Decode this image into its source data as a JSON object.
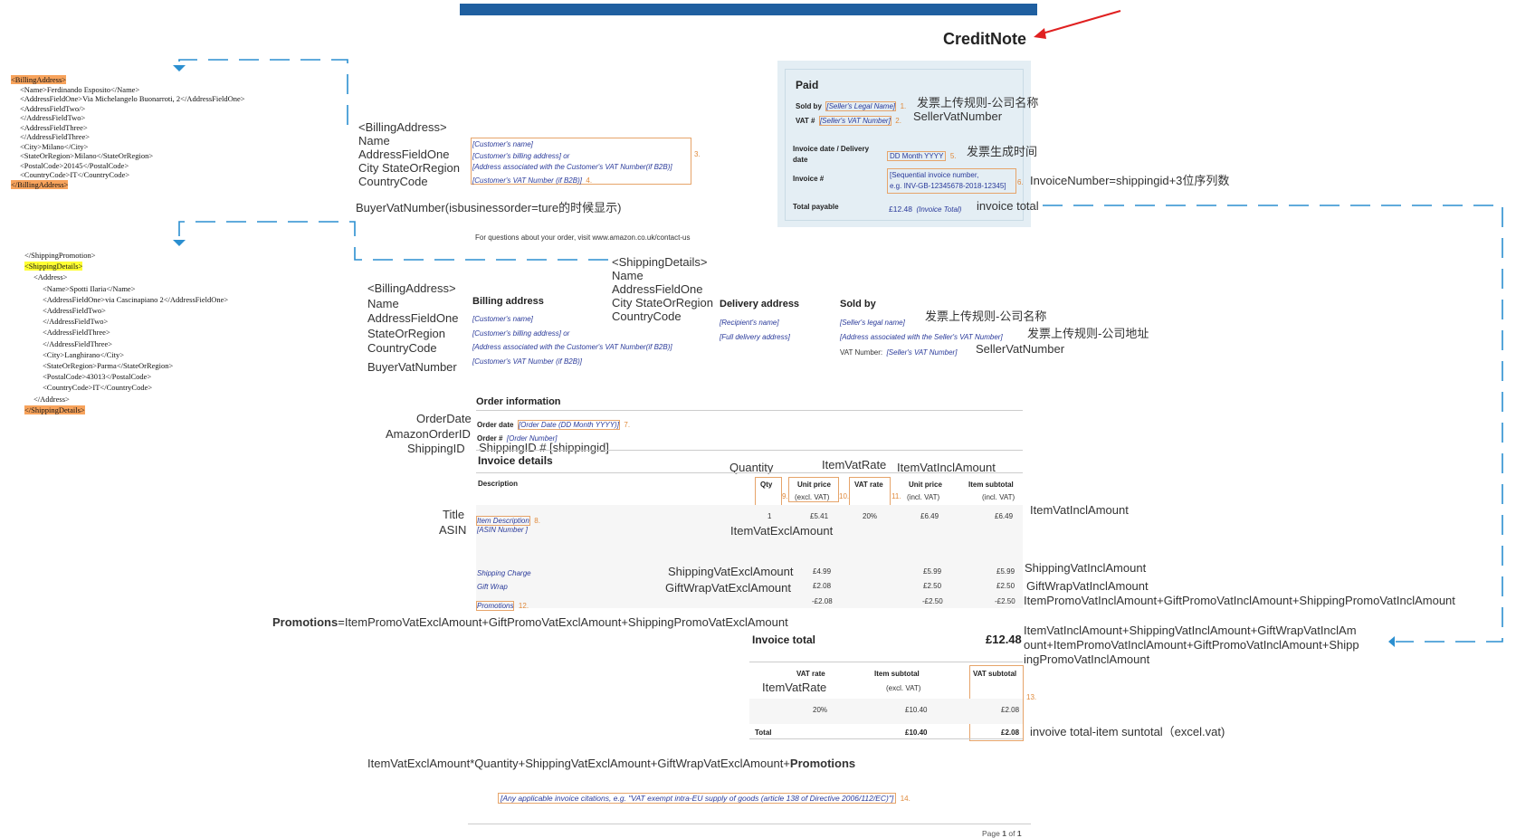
{
  "doc_title": "CreditNote",
  "xml_billing": {
    "lines": [
      "<BillingAddress>",
      "  <Name>Ferdinando Esposito</Name>",
      "  <AddressFieldOne>Via Michelangelo Buonarroti, 2</AddressFieldOne>",
      "  <AddressFieldTwo/>",
      "  </AddressFieldTwo>",
      "  <AddressFieldThree>",
      "  </AddressFieldThree>",
      "  <City>Milano</City>",
      "  <StateOrRegion>Milano</StateOrRegion>",
      "  <PostalCode>20145</PostalCode>",
      "  <CountryCode>IT</CountryCode>",
      "</BillingAddress>"
    ]
  },
  "xml_shipping": {
    "lines": [
      "</ShippingPromotion>",
      "<ShippingDetails>",
      "  <Address>",
      "    <Name>Spotti Ilaria</Name>",
      "    <AddressFieldOne>via Cascinapiano 2</AddressFieldOne>",
      "    <AddressFieldTwo>",
      "    </AddressFieldTwo>",
      "    <AddressFieldThree>",
      "    </AddressFieldThree>",
      "    <City>Langhirano</City>",
      "    <StateOrRegion>Parma</StateOrRegion>",
      "    <PostalCode>43013</PostalCode>",
      "    <CountryCode>IT</CountryCode>",
      "  </Address>",
      "</ShippingDetails>"
    ]
  },
  "map_billing_1": {
    "tag": "<BillingAddress>",
    "name": "Name",
    "addr1": "AddressFieldOne",
    "city_state": "City  StateOrRegion",
    "country": "CountryCode",
    "buyer_vat": "BuyerVatNumber(isbusinessorder=ture的时候显示)"
  },
  "paid_box": {
    "title": "Paid",
    "sold_by_label": "Sold by",
    "sold_by_ph": "[Seller's Legal Name]",
    "sold_by_num": "1.",
    "sold_by_note": "发票上传规则-公司名称",
    "vat_label": "VAT #",
    "vat_ph": "[Seller's VAT Number]",
    "vat_num": "2.",
    "vat_note": "SellerVatNumber",
    "date_label": "Invoice date / Delivery date",
    "date_ph": "DD Month YYYY",
    "date_num": "5.",
    "date_note": "发票生成时间",
    "inv_label": "Invoice #",
    "inv_ph1": "[Sequential invoice number,",
    "inv_ph2": "e.g. INV-GB-12345678-2018-12345]",
    "inv_num": "6.",
    "inv_note": "InvoiceNumber=shippingid+3位序列数",
    "total_label": "Total payable",
    "total_value": "£12.48",
    "total_ph": "(Invoice Total)",
    "total_note": "invoice total"
  },
  "customer_block": {
    "l1": "[Customer's name]",
    "l2": "[Customer's billing address] or",
    "l3": "[Address associated with the Customer's VAT Number(if B2B)]",
    "l4": "[Customer's VAT Number (if B2B)]",
    "n3": "3.",
    "n4": "4."
  },
  "contact_line": "For questions about your order, visit www.amazon.co.uk/contact-us",
  "map_shipping": {
    "tag": "<ShippingDetails>",
    "name": "Name",
    "addr1": "AddressFieldOne",
    "city_state": "City  StateOrRegion",
    "country": "CountryCode"
  },
  "map_billing_2": {
    "tag": "<BillingAddress>",
    "name": "Name",
    "addr1": "AddressFieldOne",
    "state": "StateOrRegion",
    "country": "CountryCode",
    "buyer_vat": "BuyerVatNumber"
  },
  "billing_section": {
    "heading": "Billing address",
    "l1": "[Customer's name]",
    "l2": "[Customer's billing address] or",
    "l3": "[Address associated with the Customer's VAT Number(if B2B)]",
    "l4": "[Customer's VAT Number (if B2B)]"
  },
  "delivery_section": {
    "heading": "Delivery address",
    "l1": "[Recipient's name]",
    "l2": "[Full delivery address]"
  },
  "soldby_section": {
    "heading": "Sold by",
    "l1": "[Seller's legal name]",
    "l2": "[Address associated with the Seller's VAT Number]",
    "vat_prefix": "VAT Number:",
    "vat_ph": "[Seller's VAT Number]",
    "note1": "发票上传规则-公司名称",
    "note2": "发票上传规则-公司地址",
    "note3": "SellerVatNumber"
  },
  "order_info": {
    "heading": "Order information",
    "date_label": "Order date",
    "date_ph": "[Order Date (DD Month YYYY)]",
    "date_num": "7.",
    "order_label": "Order #",
    "order_ph": "[Order Number]",
    "map_order_date": "OrderDate",
    "map_order_id": "AmazonOrderID",
    "map_shipping_id": "ShippingID",
    "shipping_line": "ShippingID # [shippingid]"
  },
  "invoice_details": {
    "heading": "Invoice details",
    "map_quantity": "Quantity",
    "map_vat_rate": "ItemVatRate",
    "map_vat_incl": "ItemVatInclAmount",
    "col_description": "Description",
    "col_qty": "Qty",
    "col_unit_price": "Unit price",
    "col_unit_price_sub": "(excl. VAT)",
    "col_vat_rate": "VAT rate",
    "col_unit_price2": "Unit price",
    "col_unit_price2_sub": "(incl. VAT)",
    "col_item_subtotal": "Item subtotal",
    "col_item_subtotal_sub": "(incl. VAT)",
    "n9": "9.",
    "n10": "10.",
    "n11": "11.",
    "map_title": "Title",
    "map_asin": "ASIN",
    "item_desc_ph": "Item Description",
    "n8": "8.",
    "asin_ph": "[ASIN Number ]",
    "item_qty": "1",
    "item_unit_excl": "£5.41",
    "item_vat": "20%",
    "item_unit_incl": "£6.49",
    "item_subtotal": "£6.49",
    "map_item_vat_incl_right": "ItemVatInclAmount",
    "map_item_vat_excl": "ItemVatExclAmount",
    "shipping_label": "Shipping Charge",
    "shipping_excl": "£4.99",
    "shipping_incl": "£5.99",
    "shipping_sub": "£5.99",
    "map_shipping_excl": "ShippingVatExclAmount",
    "map_shipping_incl": "ShippingVatInclAmount",
    "giftwrap_label": "Gift Wrap",
    "giftwrap_excl": "£2.08",
    "giftwrap_incl": "£2.50",
    "giftwrap_sub": "£2.50",
    "map_giftwrap_excl": "GiftWrapVatExclAmount",
    "map_giftwrap_incl": "GiftWrapVatInclAmount",
    "promo_label": "Promotions",
    "n12": "12.",
    "promo_excl": "-£2.08",
    "promo_incl": "-£2.50",
    "promo_sub": "-£2.50",
    "map_promo_incl": "ItemPromoVatInclAmount+GiftPromoVatInclAmount+ShippingPromoVatInclAmount",
    "promo_formula_bold": "Promotions",
    "promo_formula_rest": "=ItemPromoVatExclAmount+GiftPromoVatExclAmount+ShippingPromoVatExclAmount"
  },
  "invoice_total": {
    "label": "Invoice total",
    "value": "£12.48",
    "formula_1": "ItemVatInclAmount+ShippingVatInclAmount+GiftWrapVatInclAm",
    "formula_2": "ount+ItemPromoVatInclAmount+GiftPromoVatInclAmount+Shipp",
    "formula_3": "ingPromoVatInclAmount"
  },
  "vat_summary": {
    "col_rate": "VAT rate",
    "map_rate": "ItemVatRate",
    "col_subtotal": "Item subtotal",
    "col_subtotal_sub": "(excl. VAT)",
    "col_vat_subtotal": "VAT subtotal",
    "n13": "13.",
    "row_rate": "20%",
    "row_subtotal": "£10.40",
    "row_vat": "£2.08",
    "total_label": "Total",
    "total_subtotal": "£10.40",
    "total_vat": "£2.08",
    "note": "invoive total-item suntotal（excel.vat)"
  },
  "bottom_formula": {
    "rest": "ItemVatExclAmount*Quantity+ShippingVatExclAmount+GiftWrapVatExclAmount+",
    "bold": "Promotions"
  },
  "citation": {
    "text": "[Any applicable invoice citations, e.g. \"VAT exempt intra-EU supply of goods (article 138 of Directive 2006/112/EC)\"]",
    "num": "14."
  },
  "footer": {
    "prefix": "Page",
    "page": "1",
    "of": "of",
    "total": "1"
  },
  "colors": {
    "top_bar": "#1f5fa0",
    "paid_box_bg": "#e4eef4",
    "dashed_line": "#2b8fd0",
    "arrow": "#e02020",
    "highlight_orange": "#f7a35c",
    "highlight_yellow": "#ffff33",
    "orange_box": "#e6a46a"
  }
}
